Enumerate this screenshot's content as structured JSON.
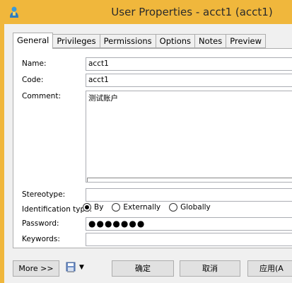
{
  "window": {
    "title": "User Properties - acct1 (acct1)"
  },
  "tabs": [
    {
      "label": "General",
      "active": true
    },
    {
      "label": "Privileges"
    },
    {
      "label": "Permissions"
    },
    {
      "label": "Options"
    },
    {
      "label": "Notes"
    },
    {
      "label": "Preview"
    }
  ],
  "form": {
    "name_label": "Name:",
    "name_value": "acct1",
    "code_label": "Code:",
    "code_value": "acct1",
    "comment_label": "Comment:",
    "comment_value": "测试账户",
    "stereotype_label": "Stereotype:",
    "stereotype_value": "",
    "identification_label": "Identification type:",
    "identification_options": [
      "By",
      "Externally",
      "Globally"
    ],
    "identification_selected": "By",
    "password_label": "Password:",
    "password_value": "●●●●●●●",
    "keywords_label": "Keywords:",
    "keywords_value": ""
  },
  "buttons": {
    "more": "More >>",
    "ok": "确定",
    "cancel": "取消",
    "apply": "应用(A"
  },
  "icons": {
    "app": "user-properties-icon",
    "save_menu": "save-dropdown-icon",
    "caret": "dropdown-arrow-icon"
  },
  "colors": {
    "titlebar": "#f0b73c",
    "client": "#f0f0f0"
  }
}
